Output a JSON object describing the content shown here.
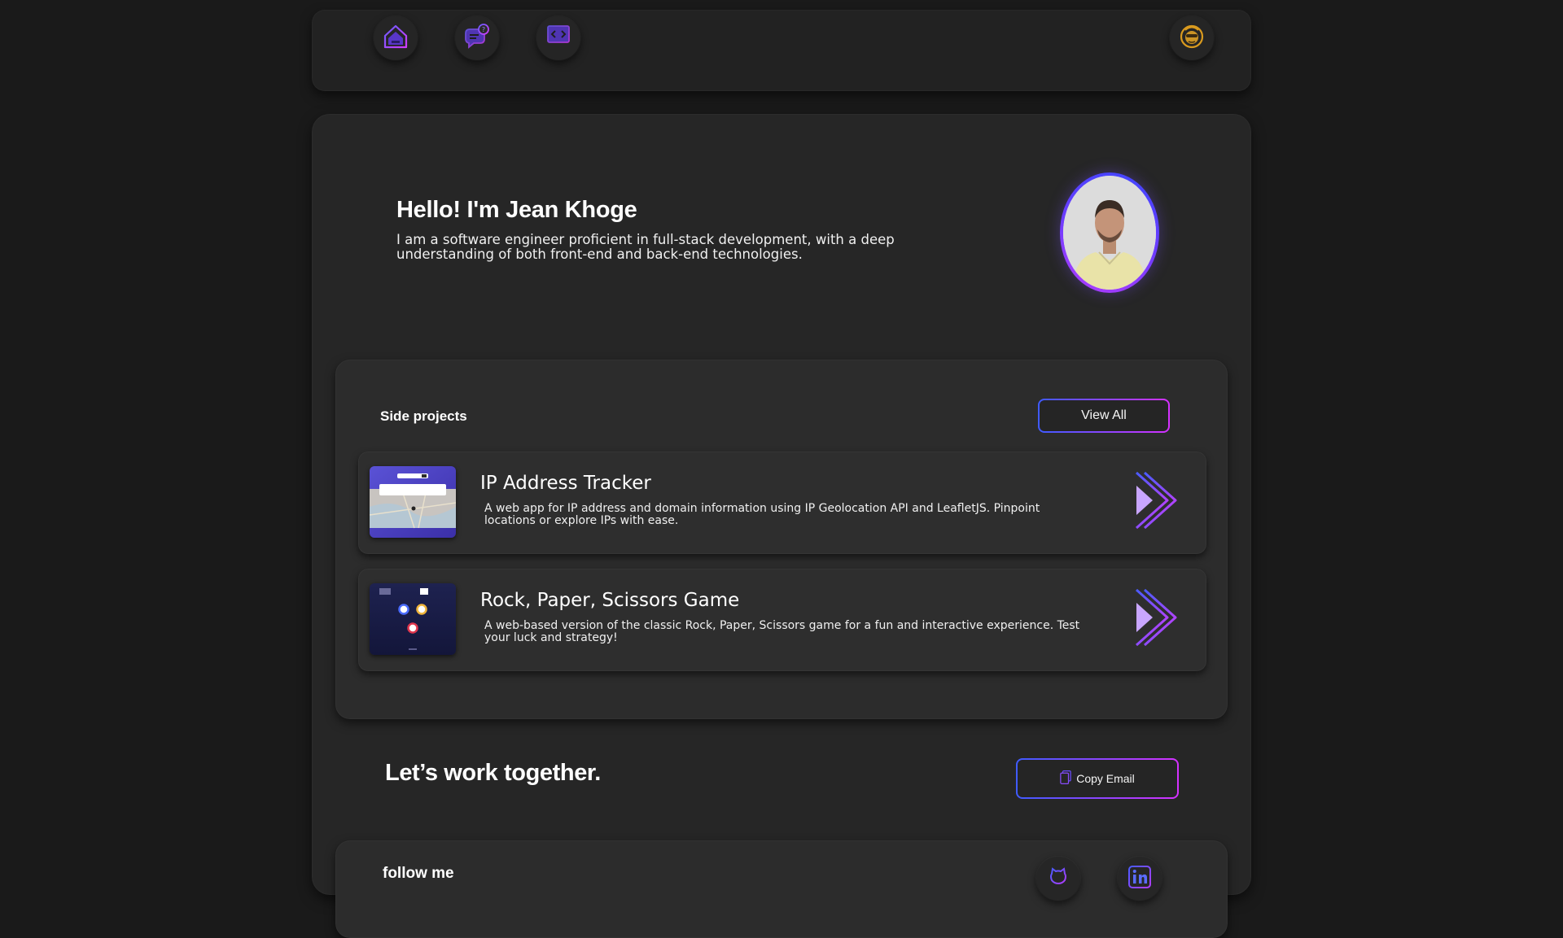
{
  "nav": {
    "items": [
      {
        "name": "home",
        "icon": "home-icon"
      },
      {
        "name": "contact",
        "icon": "chat-icon"
      },
      {
        "name": "projects",
        "icon": "code-monitor-icon"
      }
    ],
    "profile_icon": "hacker-avatar-icon"
  },
  "hero": {
    "title": "Hello! I'm Jean Khoge",
    "description": "I am a software engineer proficient in full-stack development, with a deep understanding of both front-end and back-end technologies.",
    "avatar_icon": "profile-photo"
  },
  "projects": {
    "title": "Side projects",
    "view_all_label": "View All",
    "items": [
      {
        "title": "IP Address Tracker",
        "description": "A web app for IP address and domain information using IP Geolocation API and LeafletJS. Pinpoint locations or explore IPs with ease."
      },
      {
        "title": "Rock, Paper, Scissors Game",
        "description": "A web-based version of the classic Rock, Paper, Scissors game for a fun and interactive experience. Test your luck and strategy!"
      }
    ]
  },
  "together": {
    "title": "Let’s work together.",
    "copy_email_label": "Copy Email"
  },
  "follow": {
    "title": "follow me",
    "links": [
      "github-icon",
      "linkedin-icon"
    ]
  },
  "colors": {
    "background": "#1a1a1a",
    "card": "#262626",
    "accent_blue": "#3f5bff",
    "accent_magenta": "#d531ff",
    "accent_purple": "#7a3cff"
  }
}
